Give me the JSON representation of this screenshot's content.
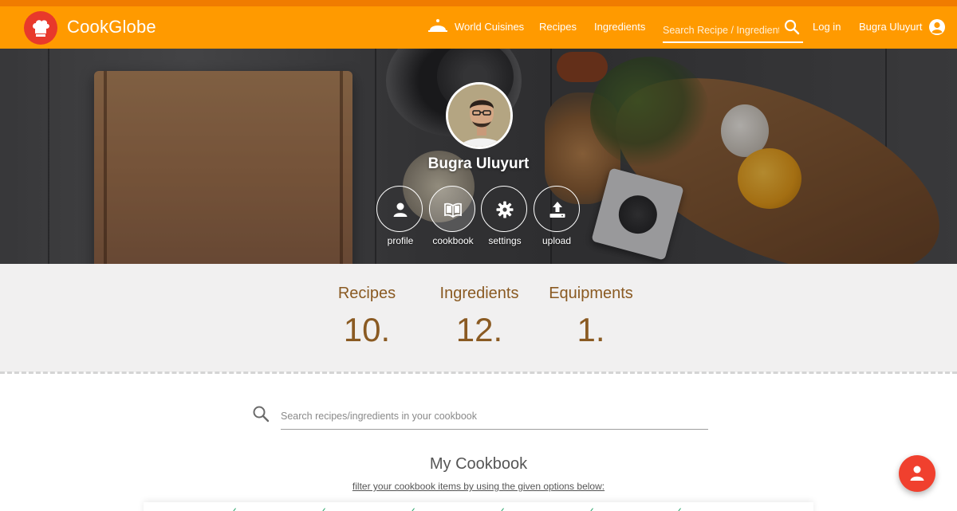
{
  "header": {
    "brand": "CookGlobe",
    "nav": {
      "world_cuisines": "World Cuisines",
      "recipes": "Recipes",
      "ingredients": "Ingredients"
    },
    "search_placeholder": "Search Recipe / Ingredient",
    "login": "Log in",
    "user_name": "Bugra Uluyurt",
    "icons": [
      "chef-hat-logo",
      "cloche-icon",
      "search-icon",
      "user-circle-icon"
    ],
    "colors": {
      "bar": "#ff9a00",
      "strip": "#f07c00",
      "logo": "#e8392b"
    }
  },
  "profile": {
    "name": "Bugra Uluyurt",
    "buttons": [
      {
        "label": "profile",
        "icon": "person-icon"
      },
      {
        "label": "cookbook",
        "icon": "open-book-icon"
      },
      {
        "label": "settings",
        "icon": "gear-icon"
      },
      {
        "label": "upload",
        "icon": "upload-icon"
      }
    ]
  },
  "stats": [
    {
      "label": "Recipes",
      "value": "10."
    },
    {
      "label": "Ingredients",
      "value": "12."
    },
    {
      "label": "Equipments",
      "value": "1."
    }
  ],
  "cookbook": {
    "search_placeholder": "Search recipes/ingredients in your cookbook",
    "title": "My Cookbook",
    "subtitle": "filter your cookbook items by using the given options below:",
    "fab_icon": "person-icon"
  },
  "colors": {
    "stat_text": "#8a5a22",
    "fab": "#f0402e",
    "check": "#2aa56a"
  }
}
